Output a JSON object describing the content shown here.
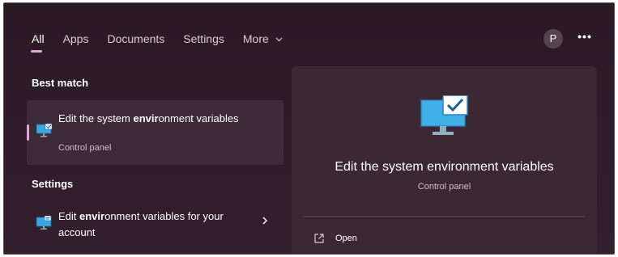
{
  "tabs": [
    {
      "label": "All",
      "active": true
    },
    {
      "label": "Apps"
    },
    {
      "label": "Documents"
    },
    {
      "label": "Settings"
    },
    {
      "label": "More"
    }
  ],
  "user": {
    "avatar_initial": "P",
    "more_options_label": "•••"
  },
  "best_match": {
    "heading": "Best match",
    "title_prefix": "Edit the system ",
    "title_highlight": "envir",
    "title_suffix": "onment variables",
    "subtitle": "Control panel",
    "icon": "system-environment-monitor-icon"
  },
  "settings": {
    "heading": "Settings",
    "item": {
      "prefix": "Edit ",
      "highlight": "envir",
      "suffix": "onment variables for your account",
      "icon": "settings-monitor-icon",
      "arrow_icon": "chevron-right-icon"
    }
  },
  "preview": {
    "title": "Edit the system environment variables",
    "subtitle": "Control panel",
    "actions": [
      {
        "label": "Open",
        "icon": "open-external-icon"
      }
    ]
  },
  "colors": {
    "accent": "#e7a2d6",
    "background": "#2e1b27",
    "panel": "#3b2833",
    "selected_card": "#3e2b37"
  }
}
